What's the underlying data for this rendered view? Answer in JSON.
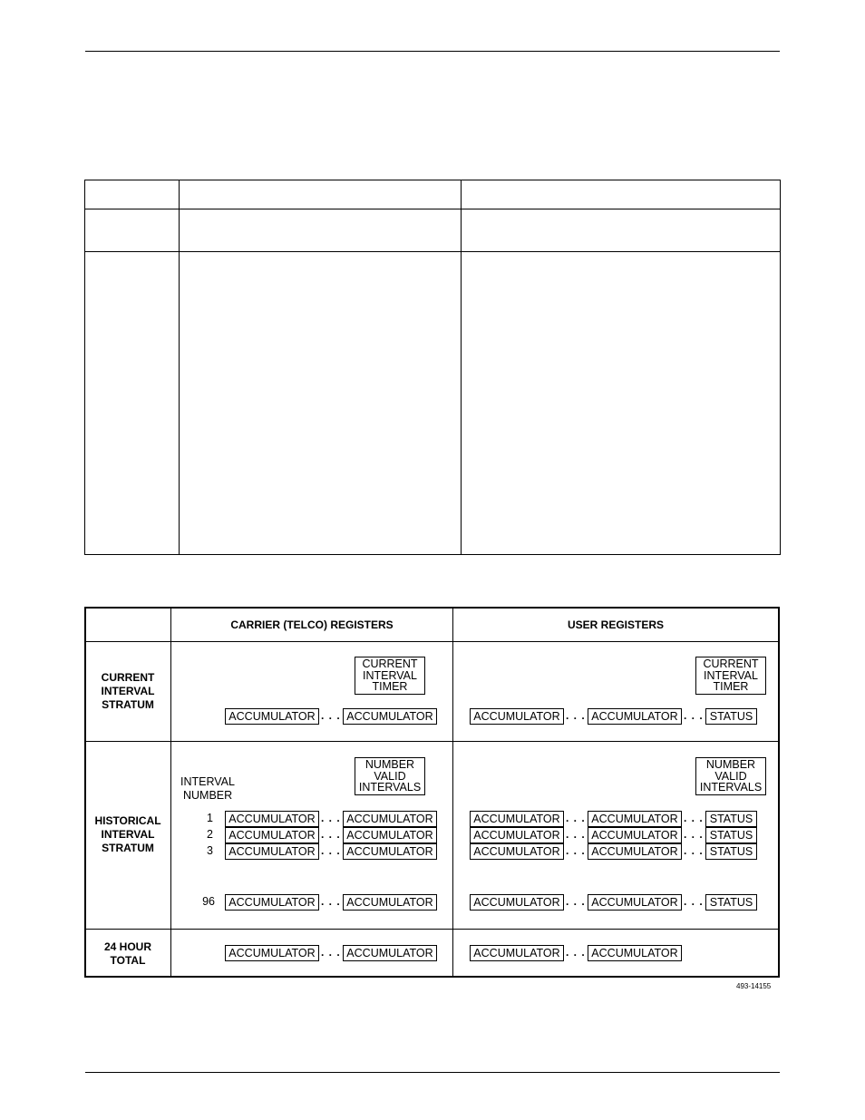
{
  "empty_table": {
    "columns": 3,
    "rows": 3,
    "cells": []
  },
  "diagram": {
    "column_headers": [
      "",
      "CARRIER (TELCO) REGISTERS",
      "USER REGISTERS"
    ],
    "rows": [
      {
        "label": [
          "CURRENT",
          "INTERVAL",
          "STRATUM"
        ],
        "carrier": {
          "top_box": [
            "CURRENT",
            "INTERVAL",
            "TIMER"
          ],
          "registers": [
            "ACCUMULATOR",
            "ACCUMULATOR"
          ]
        },
        "user": {
          "top_box": [
            "CURRENT",
            "INTERVAL",
            "TIMER"
          ],
          "registers": [
            "ACCUMULATOR",
            "ACCUMULATOR",
            "STATUS"
          ]
        }
      },
      {
        "label": [
          "HISTORICAL",
          "INTERVAL",
          "STRATUM"
        ],
        "interval_label": [
          "INTERVAL",
          "NUMBER"
        ],
        "interval_numbers": [
          "1",
          "2",
          "3",
          "96"
        ],
        "carrier": {
          "top_box": [
            "NUMBER",
            "VALID",
            "INTERVALS"
          ],
          "registers": [
            "ACCUMULATOR",
            "ACCUMULATOR"
          ]
        },
        "user": {
          "top_box": [
            "NUMBER",
            "VALID",
            "INTERVALS"
          ],
          "registers": [
            "ACCUMULATOR",
            "ACCUMULATOR",
            "STATUS"
          ]
        }
      },
      {
        "label": [
          "24 HOUR",
          "TOTAL"
        ],
        "carrier": {
          "registers": [
            "ACCUMULATOR",
            "ACCUMULATOR"
          ]
        },
        "user": {
          "registers": [
            "ACCUMULATOR",
            "ACCUMULATOR"
          ]
        }
      }
    ],
    "ellipsis": ". . .",
    "figure_number": "493-14155"
  }
}
